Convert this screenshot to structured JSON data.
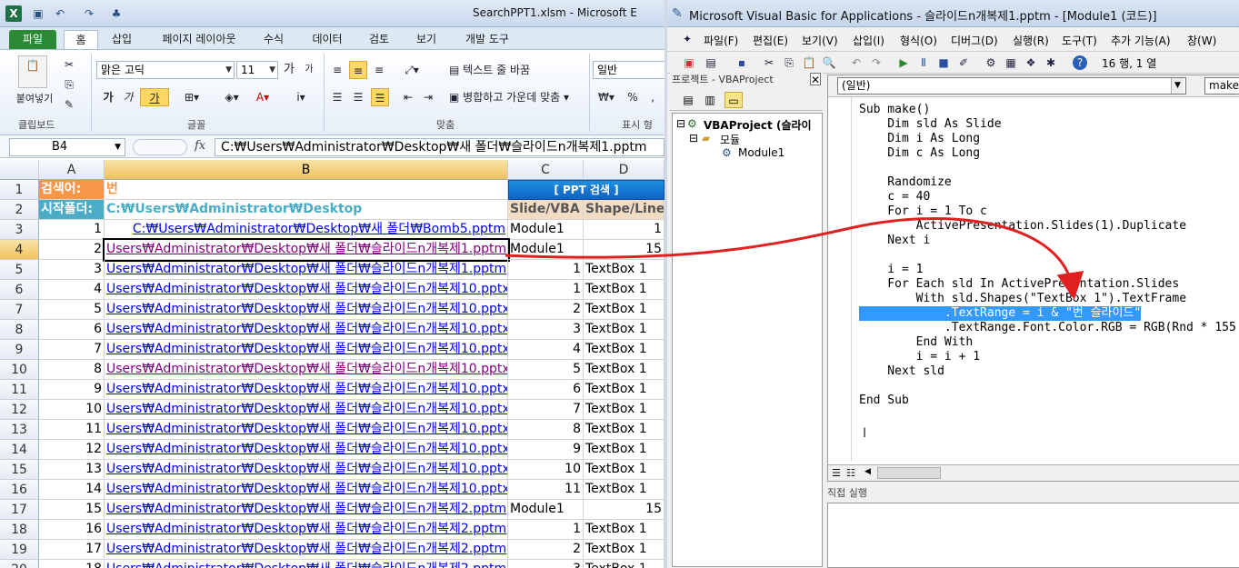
{
  "excel": {
    "window_title": "SearchPPT1.xlsm - Microsoft E",
    "tabs": [
      "파일",
      "홈",
      "삽입",
      "페이지 레이아웃",
      "수식",
      "데이터",
      "검토",
      "보기",
      "개발 도구"
    ],
    "clipboard": {
      "paste_label": "붙여넣기",
      "group": "클립보드"
    },
    "font": {
      "name": "맑은 고딕",
      "size": "11",
      "group": "글꼴",
      "grow": "가",
      "shrink": "가",
      "bold": "가",
      "italic": "가",
      "underline": "가"
    },
    "align": {
      "wrap": "텍스트 줄 바꿈",
      "merge": "병합하고 가운데 맞춤",
      "group": "맞춤"
    },
    "number": {
      "format": "일반",
      "group": "표시 형",
      "percent": "%"
    },
    "name_box": "B4",
    "formula": "C:₩Users₩Administrator₩Desktop₩새 폴더₩슬라이드n개복제1.pptm",
    "columns": [
      "A",
      "B",
      "C",
      "D"
    ],
    "header_rows": [
      {
        "num": "1",
        "A": "검색어:",
        "B": "번",
        "CD": "[ PPT 검색 ]"
      },
      {
        "num": "2",
        "A": "시작폴더:",
        "B": "C:₩Users₩Administrator₩Desktop",
        "C": "Slide/VBA",
        "D": "Shape/Line"
      }
    ],
    "rows": [
      {
        "num": "3",
        "a": "1",
        "b": "C:₩Users₩Administrator₩Desktop₩새 폴더₩Bomb5.pptm",
        "c": "Module1",
        "d": "1",
        "style": "link",
        "c_num": false,
        "d_num": true
      },
      {
        "num": "4",
        "a": "2",
        "b": "Users₩Administrator₩Desktop₩새 폴더₩슬라이드n개복제1.pptm",
        "c": "Module1",
        "d": "15",
        "style": "visited",
        "c_num": false,
        "d_num": true
      },
      {
        "num": "5",
        "a": "3",
        "b": "Users₩Administrator₩Desktop₩새 폴더₩슬라이드n개복제1.pptm",
        "c": "1",
        "d": "TextBox 1",
        "style": "link",
        "c_num": true,
        "d_num": false
      },
      {
        "num": "6",
        "a": "4",
        "b": "Users₩Administrator₩Desktop₩새 폴더₩슬라이드n개복제10.pptx",
        "c": "1",
        "d": "TextBox 1",
        "style": "link",
        "c_num": true,
        "d_num": false
      },
      {
        "num": "7",
        "a": "5",
        "b": "Users₩Administrator₩Desktop₩새 폴더₩슬라이드n개복제10.pptx",
        "c": "2",
        "d": "TextBox 1",
        "style": "link",
        "c_num": true,
        "d_num": false
      },
      {
        "num": "8",
        "a": "6",
        "b": "Users₩Administrator₩Desktop₩새 폴더₩슬라이드n개복제10.pptx",
        "c": "3",
        "d": "TextBox 1",
        "style": "link",
        "c_num": true,
        "d_num": false
      },
      {
        "num": "9",
        "a": "7",
        "b": "Users₩Administrator₩Desktop₩새 폴더₩슬라이드n개복제10.pptx",
        "c": "4",
        "d": "TextBox 1",
        "style": "link",
        "c_num": true,
        "d_num": false
      },
      {
        "num": "10",
        "a": "8",
        "b": "Users₩Administrator₩Desktop₩새 폴더₩슬라이드n개복제10.pptx",
        "c": "5",
        "d": "TextBox 1",
        "style": "visited",
        "c_num": true,
        "d_num": false
      },
      {
        "num": "11",
        "a": "9",
        "b": "Users₩Administrator₩Desktop₩새 폴더₩슬라이드n개복제10.pptx",
        "c": "6",
        "d": "TextBox 1",
        "style": "link",
        "c_num": true,
        "d_num": false
      },
      {
        "num": "12",
        "a": "10",
        "b": "Users₩Administrator₩Desktop₩새 폴더₩슬라이드n개복제10.pptx",
        "c": "7",
        "d": "TextBox 1",
        "style": "link",
        "c_num": true,
        "d_num": false
      },
      {
        "num": "13",
        "a": "11",
        "b": "Users₩Administrator₩Desktop₩새 폴더₩슬라이드n개복제10.pptx",
        "c": "8",
        "d": "TextBox 1",
        "style": "link",
        "c_num": true,
        "d_num": false
      },
      {
        "num": "14",
        "a": "12",
        "b": "Users₩Administrator₩Desktop₩새 폴더₩슬라이드n개복제10.pptx",
        "c": "9",
        "d": "TextBox 1",
        "style": "link",
        "c_num": true,
        "d_num": false
      },
      {
        "num": "15",
        "a": "13",
        "b": "Users₩Administrator₩Desktop₩새 폴더₩슬라이드n개복제10.pptx",
        "c": "10",
        "d": "TextBox 1",
        "style": "link",
        "c_num": true,
        "d_num": false
      },
      {
        "num": "16",
        "a": "14",
        "b": "Users₩Administrator₩Desktop₩새 폴더₩슬라이드n개복제10.pptx",
        "c": "11",
        "d": "TextBox 1",
        "style": "link",
        "c_num": true,
        "d_num": false
      },
      {
        "num": "17",
        "a": "15",
        "b": "Users₩Administrator₩Desktop₩새 폴더₩슬라이드n개복제2.pptm",
        "c": "Module1",
        "d": "15",
        "style": "link",
        "c_num": false,
        "d_num": true
      },
      {
        "num": "18",
        "a": "16",
        "b": "Users₩Administrator₩Desktop₩새 폴더₩슬라이드n개복제2.pptm",
        "c": "1",
        "d": "TextBox 1",
        "style": "link",
        "c_num": true,
        "d_num": false
      },
      {
        "num": "19",
        "a": "17",
        "b": "Users₩Administrator₩Desktop₩새 폴더₩슬라이드n개복제2.pptm",
        "c": "2",
        "d": "TextBox 1",
        "style": "link",
        "c_num": true,
        "d_num": false
      },
      {
        "num": "20",
        "a": "18",
        "b": "Users₩Administrator₩Desktop₩새 폴더₩슬라이드n개복제2.pptm",
        "c": "3",
        "d": "TextBox 1",
        "style": "link",
        "c_num": true,
        "d_num": false
      }
    ]
  },
  "vba": {
    "window_title": "Microsoft Visual Basic for Applications - 슬라이드n개복제1.pptm - [Module1 (코드)]",
    "menu": [
      "파일(F)",
      "편집(E)",
      "보기(V)",
      "삽입(I)",
      "형식(O)",
      "디버그(D)",
      "실행(R)",
      "도구(T)",
      "추가 기능(A)",
      "창(W)"
    ],
    "cursor_pos": "16 행, 1 열",
    "project_title": "프로젝트 - VBAProject",
    "tree": {
      "root": "VBAProject (슬라이",
      "modules": "모듈",
      "module1": "Module1"
    },
    "proc_left": "(일반)",
    "proc_right": "make",
    "code_lines": [
      "Sub make()",
      "    Dim sld As Slide",
      "    Dim i As Long",
      "    Dim c As Long",
      "",
      "    Randomize",
      "    c = 40",
      "    For i = 1 To c",
      "        ActivePresentation.Slides(1).Duplicate",
      "    Next i",
      "",
      "    i = 1",
      "    For Each sld In ActivePresentation.Slides",
      "        With sld.Shapes(\"TextBox 1\").TextFrame",
      "            .TextRange = i & \"번 슬라이드\"",
      "            .TextRange.Font.Color.RGB = RGB(Rnd * 155",
      "        End With",
      "        i = i + 1",
      "    Next sld",
      "",
      "End Sub"
    ],
    "immediate_label": "직접 실행"
  },
  "colors": {
    "accent_orange": "#f79646",
    "header_blue": "#4bacc6",
    "excel_green": "#1e7145",
    "arrow_red": "#e02020",
    "selection_blue": "#3399ff"
  }
}
